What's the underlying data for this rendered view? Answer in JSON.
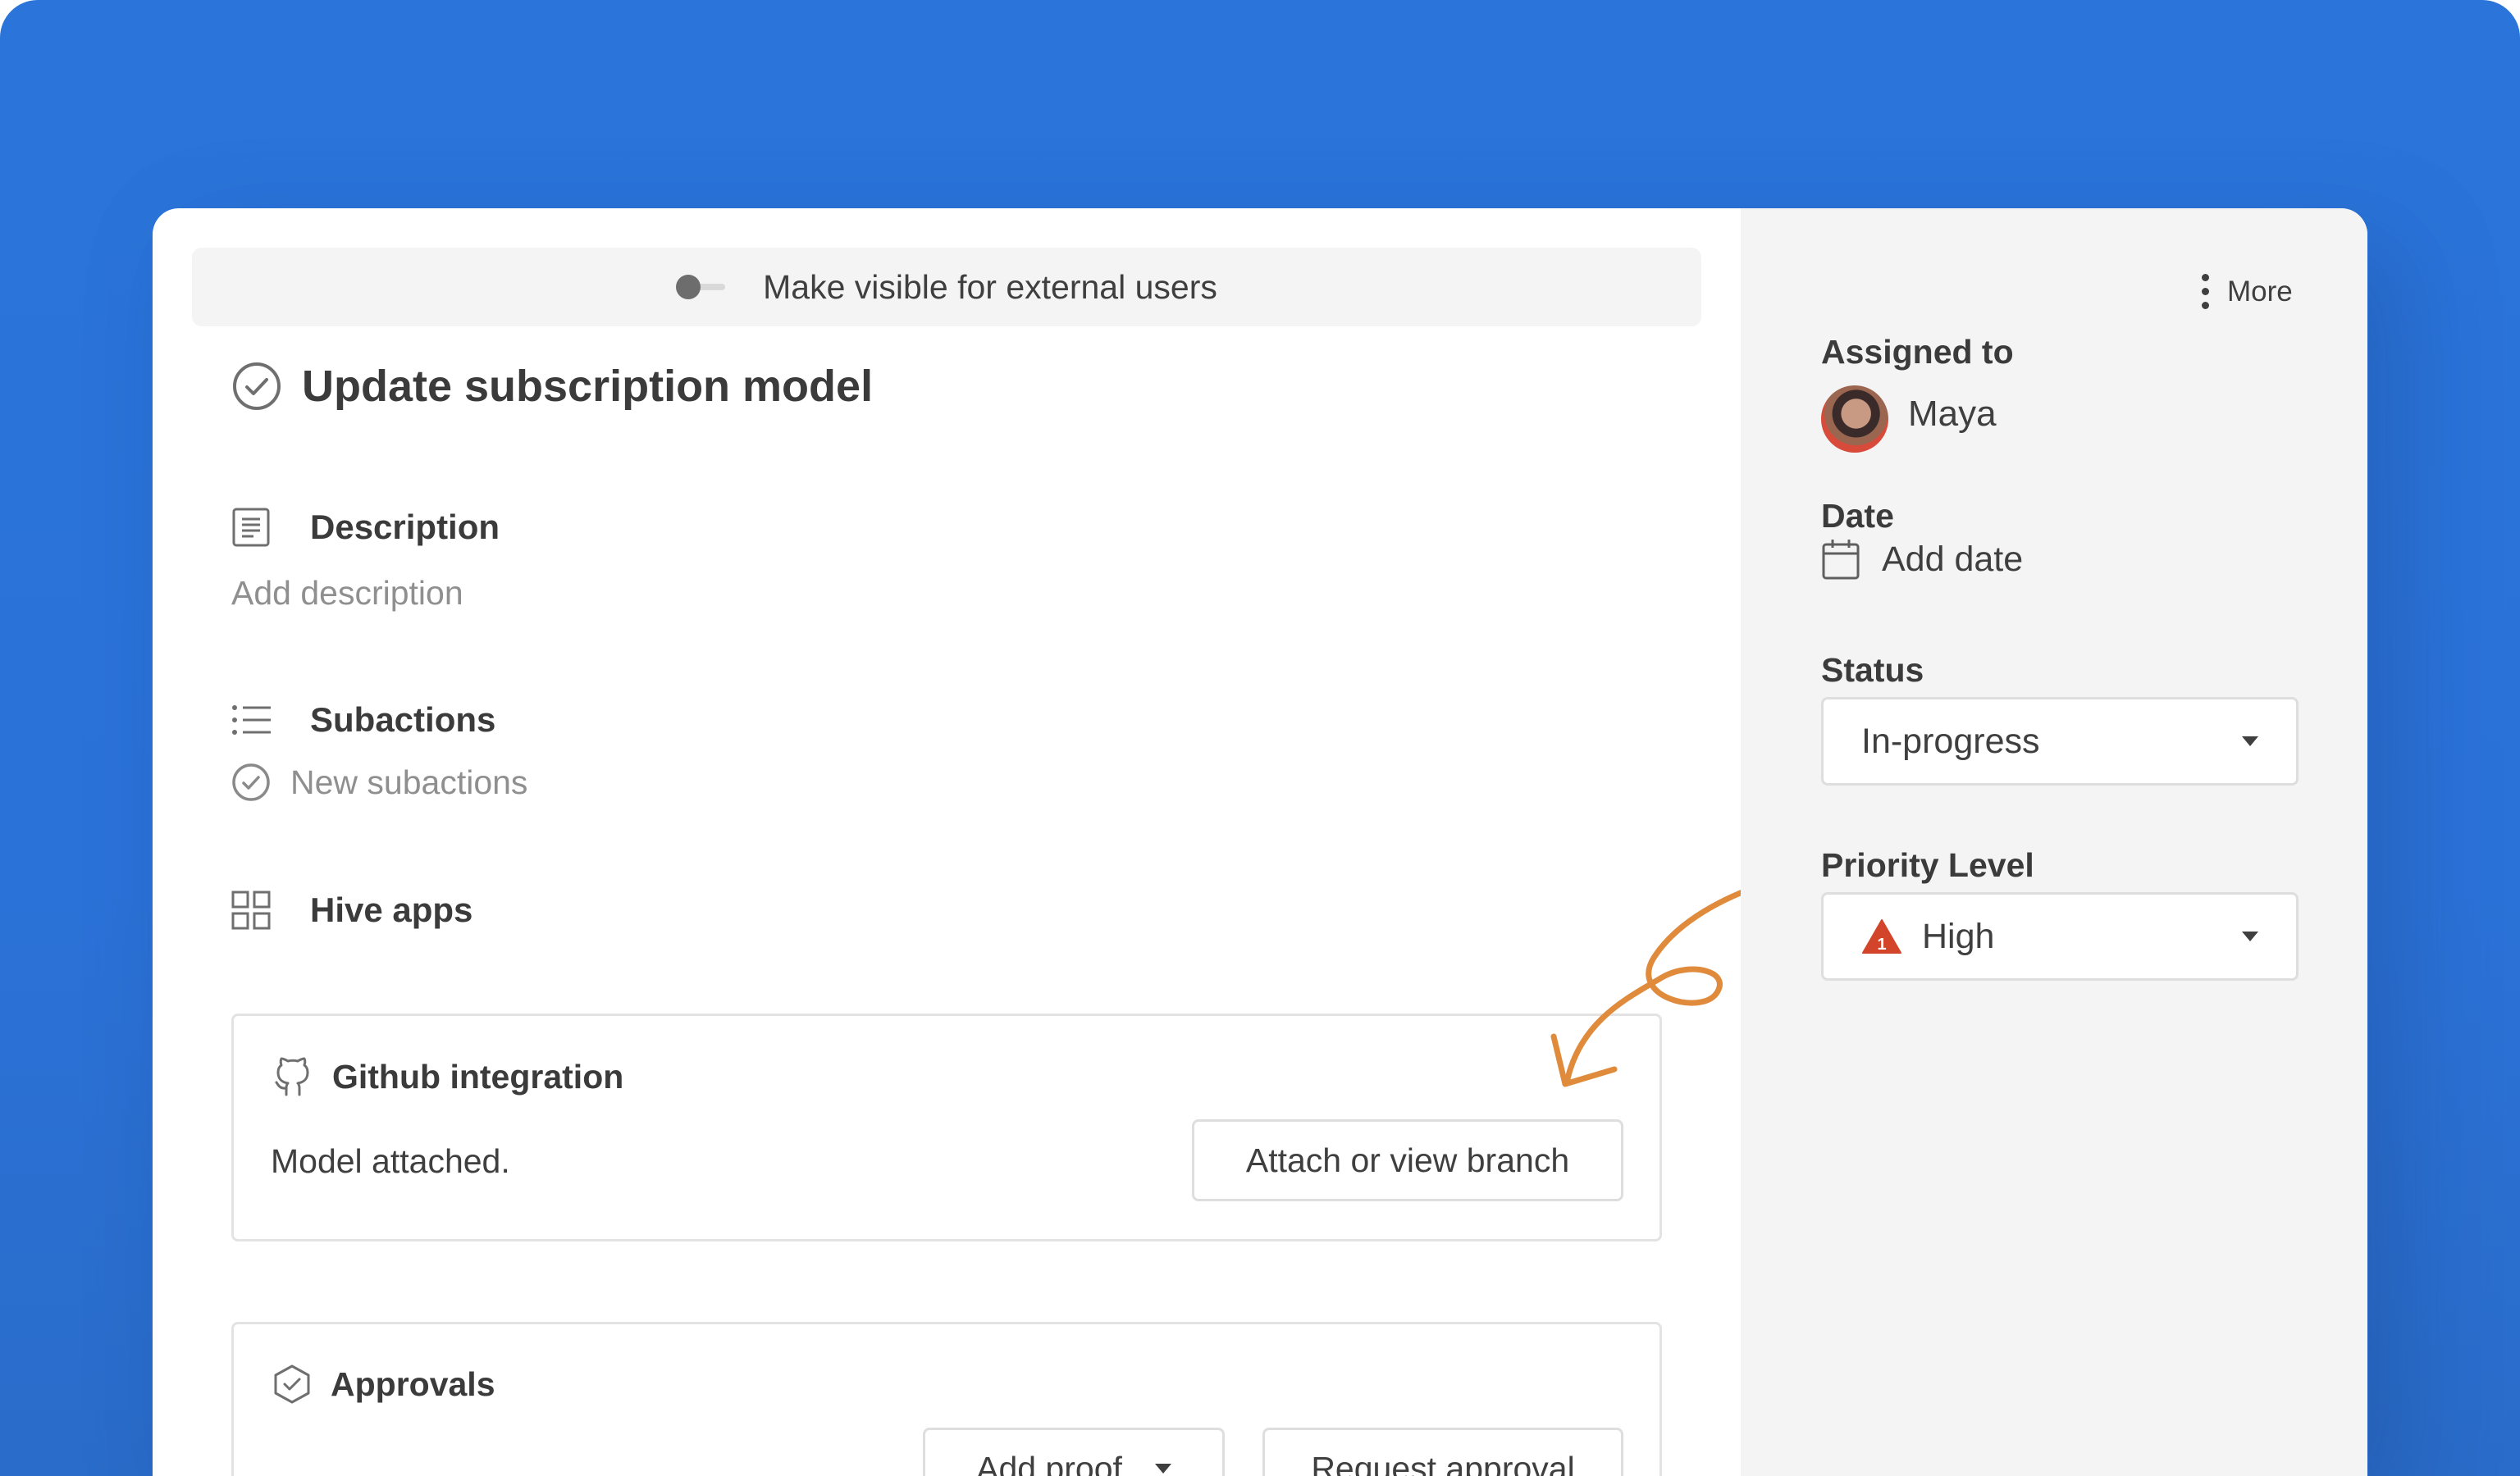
{
  "visibility": {
    "label": "Make visible for external users",
    "enabled": false
  },
  "task": {
    "title": "Update subscription model"
  },
  "description": {
    "heading": "Description",
    "placeholder": "Add description"
  },
  "subactions": {
    "heading": "Subactions",
    "new_label": "New subactions"
  },
  "hive_apps": {
    "heading": "Hive apps"
  },
  "github": {
    "title": "Github integration",
    "status": "Model attached.",
    "button": "Attach or view branch"
  },
  "approvals": {
    "title": "Approvals",
    "add_proof": "Add proof",
    "request_approval": "Request approval"
  },
  "sidebar": {
    "more": "More",
    "assigned_label": "Assigned to",
    "assignee": "Maya",
    "date_label": "Date",
    "date_value": "Add date",
    "status_label": "Status",
    "status_value": "In-progress",
    "priority_label": "Priority Level",
    "priority_value": "High",
    "priority_badge": "1"
  },
  "colors": {
    "background": "#2a74da",
    "annotation_arrow": "#e08a3c",
    "priority_high": "#d2452b"
  }
}
